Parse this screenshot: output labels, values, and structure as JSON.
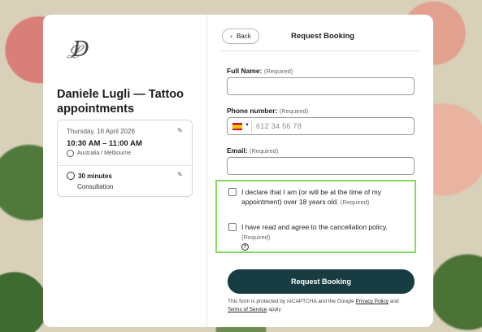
{
  "sidebar": {
    "logo_text": "DL",
    "title": "Daniele Lugli — Tattoo appointments",
    "date": "Thursday, 16 April 2026",
    "time": "10:30 AM – 11:00 AM",
    "timezone": "Australia / Melbourne",
    "duration": "30 minutes",
    "service": "Consultation"
  },
  "header": {
    "back_label": "Back",
    "title": "Request Booking"
  },
  "form": {
    "full_name_label": "Full Name:",
    "full_name_req": "(Required)",
    "full_name_value": "",
    "phone_label": "Phone number:",
    "phone_req": "(Required)",
    "phone_placeholder": "612 34 56 78",
    "email_label": "Email:",
    "email_req": "(Required)",
    "email_value": "",
    "age_text": "I declare that I am (or will be at the time of my appointment) over 18 years old.",
    "age_req": "(Required)",
    "policy_text": "I have read and agree to the cancellation policy.",
    "policy_req": "(Required)",
    "submit_label": "Request Booking"
  },
  "footer": {
    "pre": "This form is protected by reCAPTCHA and the Google ",
    "privacy": "Privacy Policy",
    "and": " and ",
    "terms": "Terms of Service",
    "post": " apply"
  },
  "colors": {
    "consent_highlight": "#87d964",
    "submit_bg": "#173c42"
  }
}
